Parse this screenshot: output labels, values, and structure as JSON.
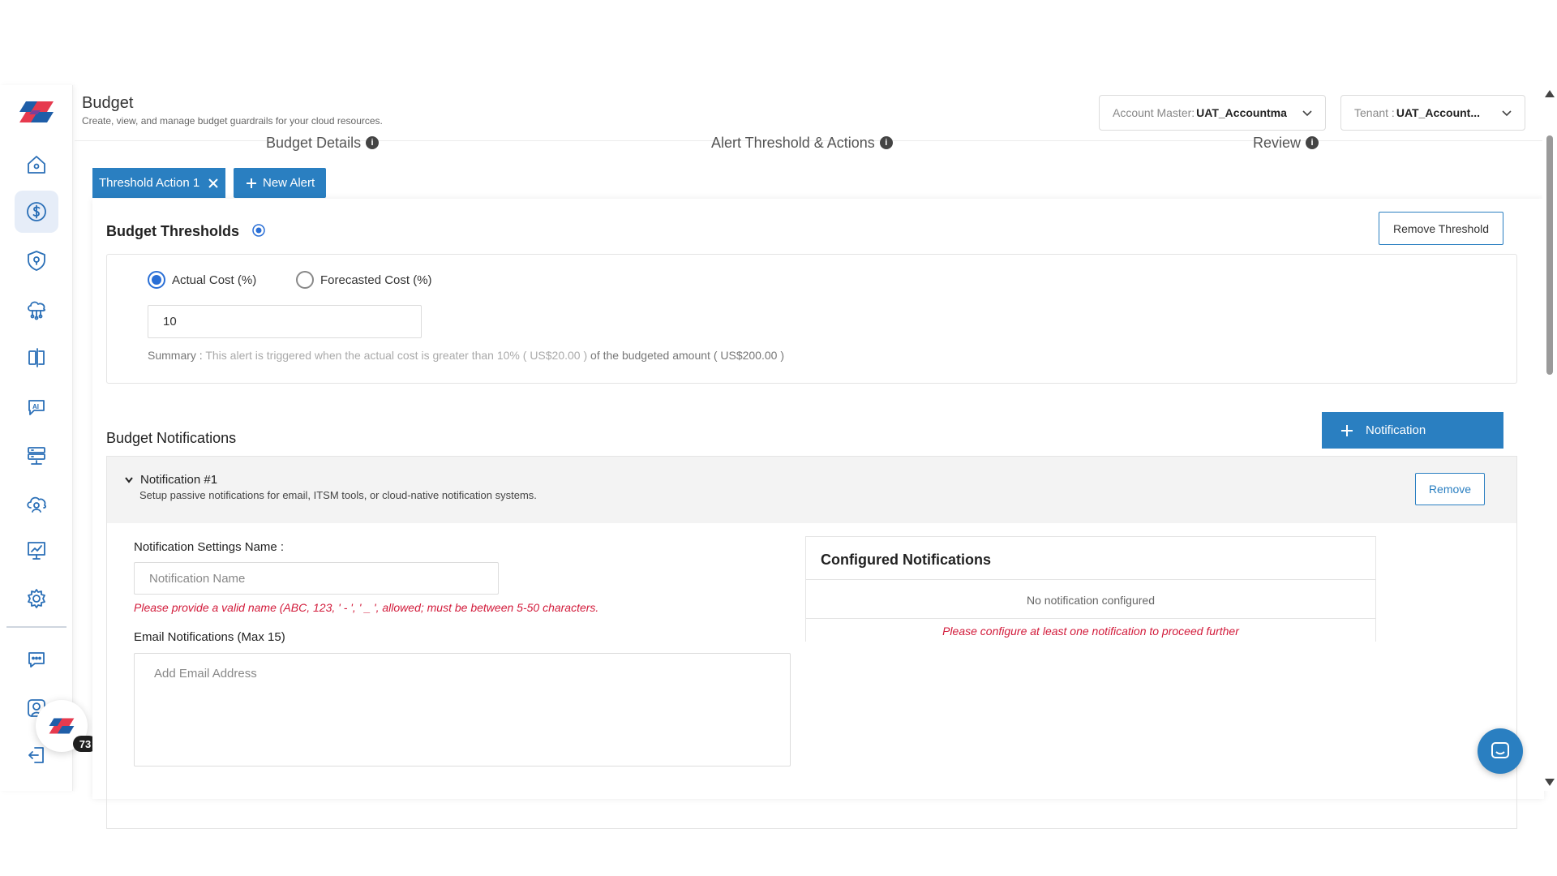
{
  "header": {
    "title": "Budget",
    "subtitle": "Create, view, and manage budget guardrails for your cloud resources.",
    "account_master_label": "Account Master:",
    "account_master_value": "UAT_Accountma",
    "tenant_label": "Tenant :",
    "tenant_value": "UAT_Account..."
  },
  "stepper": {
    "steps": [
      "Budget Details",
      "Alert Threshold & Actions",
      "Review"
    ]
  },
  "tabs": {
    "active_label": "Threshold Action 1",
    "new_label": "New Alert"
  },
  "thresholds": {
    "title": "Budget Thresholds",
    "remove_label": "Remove Threshold",
    "option_actual": "Actual Cost (%)",
    "option_forecasted": "Forecasted Cost (%)",
    "selected": "actual",
    "value": "10",
    "summary_label": "Summary :",
    "summary_text_1": "This alert is triggered when the actual cost is greater than 10%",
    "summary_amount": "( US$20.00 )",
    "summary_text_2": "of the budgeted amount ( US$200.00 )"
  },
  "notifications": {
    "title": "Budget Notifications",
    "add_label": "Notification",
    "item_name": "Notification #1",
    "item_desc": "Setup passive notifications for email, ITSM tools, or cloud-native notification systems.",
    "remove_label": "Remove",
    "settings_label": "Notification Settings Name :",
    "name_placeholder": "Notification Name",
    "name_error": "Please provide a valid name (ABC, 123, ' - ', ' _ ', allowed; must be between 5-50 characters.",
    "email_label": "Email Notifications (Max 15)",
    "email_placeholder": "Add Email Address",
    "configured_title": "Configured Notifications",
    "configured_empty": "No notification configured",
    "configured_error": "Please configure at least one notification to proceed further"
  },
  "badge": {
    "count": "73"
  },
  "colors": {
    "accent": "#2a7fc1",
    "error": "#d21a3a",
    "radio": "#2a6fd6"
  },
  "icons": {
    "sidebar": [
      "home-icon",
      "dollar-icon",
      "shield-icon",
      "cloud-network-icon",
      "compare-icon",
      "ai-chat-icon",
      "server-icon",
      "cloud-user-icon",
      "presentation-icon",
      "gear-icon",
      "chat-icon",
      "user-icon",
      "logout-icon"
    ]
  }
}
